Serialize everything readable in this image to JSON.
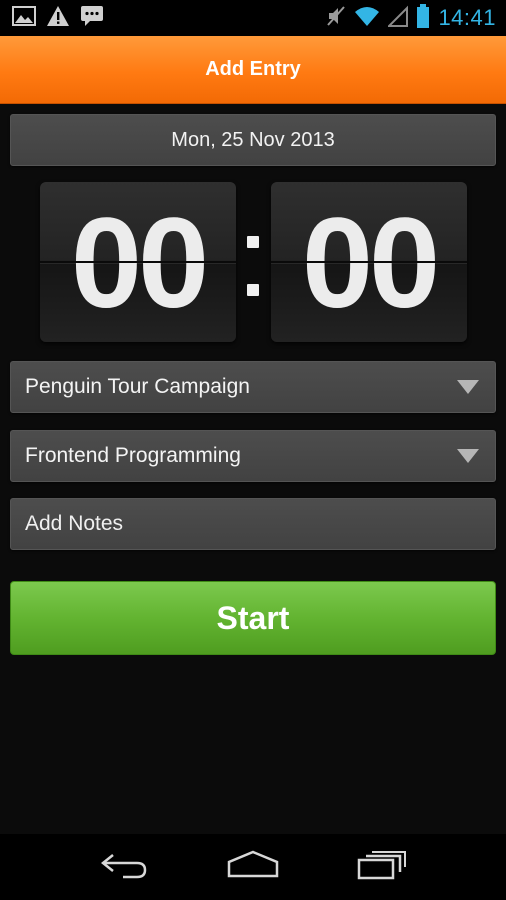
{
  "status_bar": {
    "time": "14:41",
    "icons": [
      "image-icon",
      "warning-icon",
      "message-icon",
      "mute-icon",
      "wifi-icon",
      "signal-icon",
      "battery-icon"
    ],
    "time_color": "#33b5e5"
  },
  "action_bar": {
    "title": "Add Entry",
    "color": "#ff7a12"
  },
  "date": "Mon, 25 Nov 2013",
  "timer": {
    "hours": "00",
    "minutes": "00"
  },
  "project_dropdown": {
    "selected": "Penguin Tour Campaign"
  },
  "task_dropdown": {
    "selected": "Frontend Programming"
  },
  "notes": {
    "placeholder": "Add Notes",
    "value": ""
  },
  "start_button": {
    "label": "Start",
    "color": "#63b431"
  },
  "nav_bar": {
    "buttons": [
      "back-icon",
      "home-icon",
      "recent-apps-icon"
    ]
  }
}
